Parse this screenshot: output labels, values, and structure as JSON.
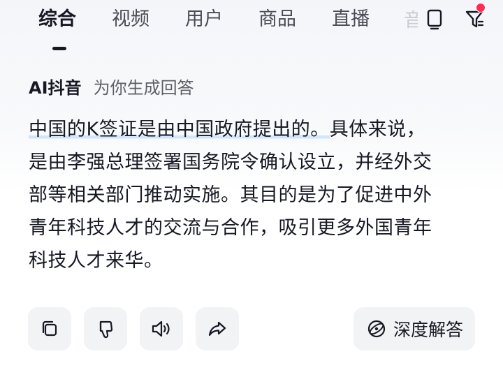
{
  "tabs": [
    {
      "label": "综合",
      "active": true
    },
    {
      "label": "视频",
      "active": false
    },
    {
      "label": "用户",
      "active": false
    },
    {
      "label": "商品",
      "active": false
    },
    {
      "label": "直播",
      "active": false
    },
    {
      "label": "音",
      "active": false
    }
  ],
  "icons": {
    "screen": "tablet-icon",
    "filter": "filter-icon",
    "copy": "copy-icon",
    "dislike": "thumbs-down-icon",
    "speaker": "speaker-icon",
    "share": "share-icon",
    "deep": "deep-answer-icon"
  },
  "ai_answer": {
    "brand": "AI抖音",
    "subtitle": "为你生成回答",
    "lines": [
      {
        "highlight": "中国的K签证是由中国政府提出的。",
        "rest": "具体来说，"
      },
      {
        "text": "是由李强总理签署国务院令确认设立，并经外交"
      },
      {
        "text": "部等相关部门推动实施。其目的是为了促进中外"
      },
      {
        "text": "青年科技人才的交流与合作，吸引更多外国青年"
      },
      {
        "text": "科技人才来华。"
      }
    ]
  },
  "actions": {
    "deep_answer_label": "深度解答"
  },
  "colors": {
    "text_primary": "#161823",
    "text_secondary": "#5d5f66",
    "button_bg": "#f2f3f5",
    "highlight": "#cfe6ff",
    "notification_dot": "#fe2c55"
  }
}
